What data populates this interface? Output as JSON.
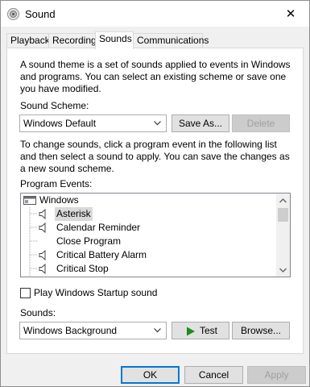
{
  "window": {
    "title": "Sound",
    "close_glyph": "✕",
    "icon": "speaker-icon"
  },
  "tabs": [
    {
      "label": "Playback"
    },
    {
      "label": "Recording"
    },
    {
      "label": "Sounds",
      "active": true
    },
    {
      "label": "Communications"
    }
  ],
  "sounds_tab": {
    "intro_text": "A sound theme is a set of sounds applied to events in Windows and programs.  You can select an existing scheme or save one you have modified.",
    "scheme_label": "Sound Scheme:",
    "scheme_value": "Windows Default",
    "save_as_label": "Save As...",
    "delete_label": "Delete",
    "instructions_text": "To change sounds, click a program event in the following list and then select a sound to apply.  You can save the changes as a new sound scheme.",
    "events_label": "Program Events:",
    "events": [
      {
        "label": "Windows",
        "level": 0,
        "has_sound": false,
        "icon": "windows-group-icon"
      },
      {
        "label": "Asterisk",
        "level": 1,
        "has_sound": true,
        "selected": true
      },
      {
        "label": "Calendar Reminder",
        "level": 1,
        "has_sound": true
      },
      {
        "label": "Close Program",
        "level": 1,
        "has_sound": false
      },
      {
        "label": "Critical Battery Alarm",
        "level": 1,
        "has_sound": true
      },
      {
        "label": "Critical Stop",
        "level": 1,
        "has_sound": true
      }
    ],
    "startup_sound_label": "Play Windows Startup sound",
    "startup_sound_checked": false,
    "sounds_label": "Sounds:",
    "sound_value": "Windows Background",
    "test_label": "Test",
    "browse_label": "Browse..."
  },
  "footer": {
    "ok_label": "OK",
    "cancel_label": "Cancel",
    "apply_label": "Apply"
  },
  "colors": {
    "accent": "#0078d7",
    "play_green": "#1a8d1a"
  }
}
